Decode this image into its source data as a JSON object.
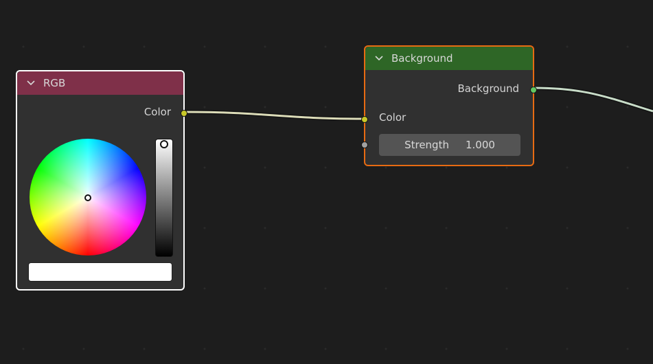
{
  "rgb_node": {
    "title": "RGB",
    "header_color": "#7f3049",
    "output_label": "Color",
    "output_socket_color": "#c7c729",
    "selected_color": "#ffffff",
    "value_level": 1.0
  },
  "background_node": {
    "title": "Background",
    "header_color": "#2e6626",
    "output_label": "Background",
    "output_socket_color": "#63c763",
    "input_color_label": "Color",
    "input_color_socket_color": "#c7c729",
    "strength": {
      "label": "Strength",
      "value": "1.000"
    },
    "strength_socket_color": "#a1a1a1"
  },
  "links": [
    {
      "from": "rgb.Color",
      "to": "background.Color",
      "color": "#dcdcb8"
    },
    {
      "from": "background.Background",
      "to": "offscreen",
      "color": "#c8dcc8"
    }
  ],
  "icons": {
    "collapse": "chevron-down-icon"
  }
}
